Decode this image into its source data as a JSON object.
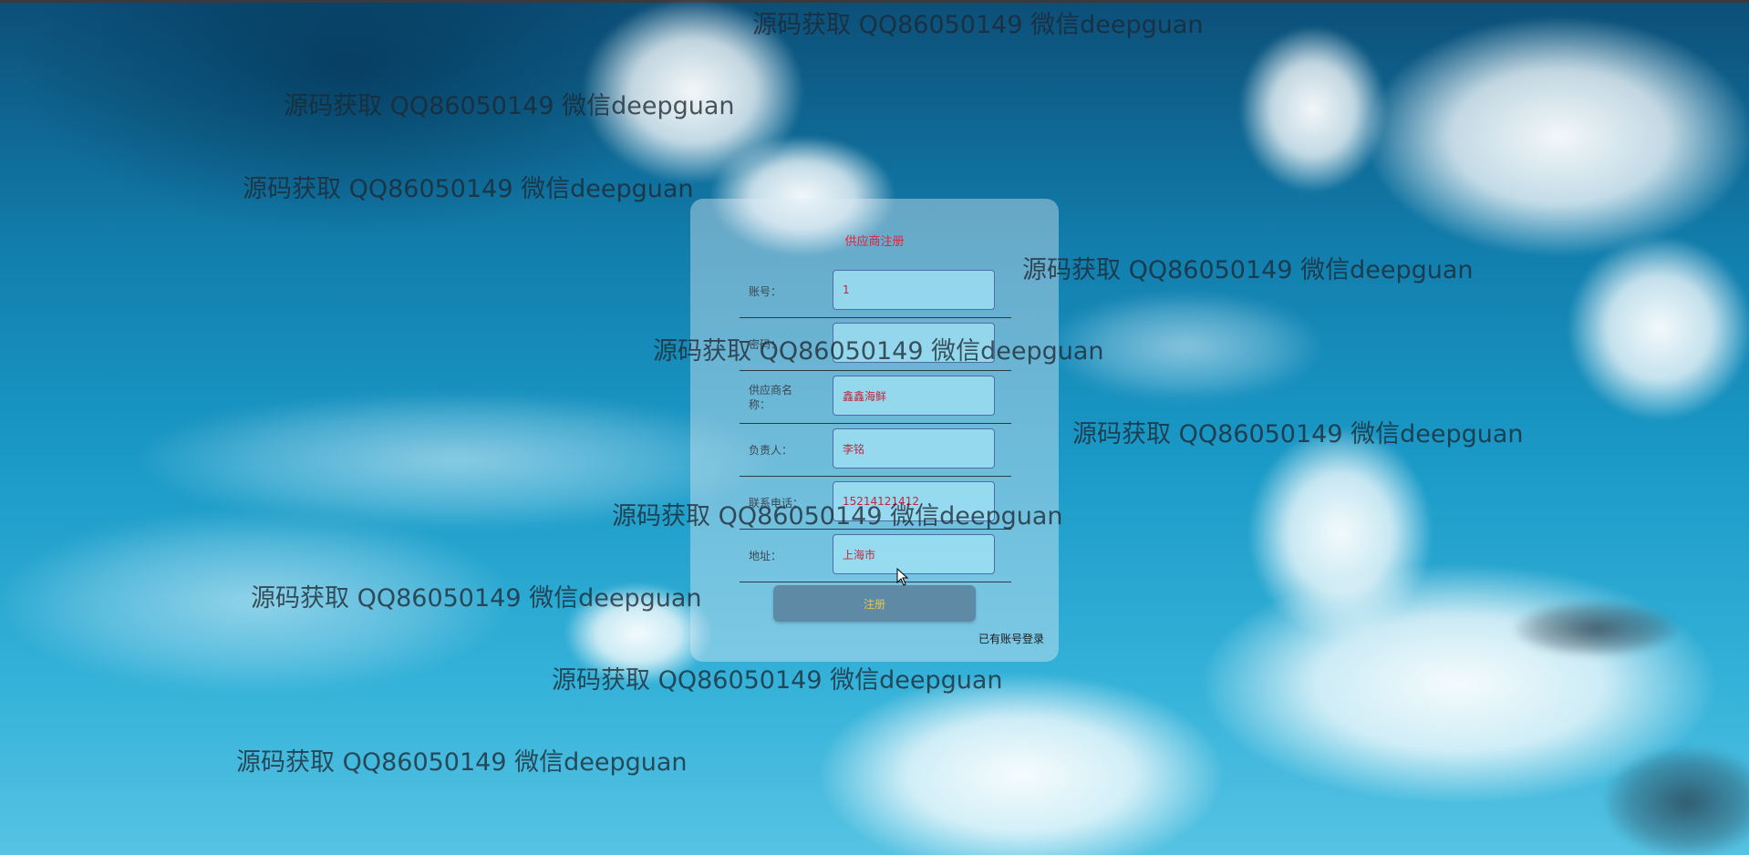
{
  "form": {
    "title": "供应商注册",
    "fields": [
      {
        "label": "账号：",
        "value": "1"
      },
      {
        "label": "密码：",
        "value": ""
      },
      {
        "label": "供应商名称：",
        "value": "鑫鑫海鲜"
      },
      {
        "label": "负责人：",
        "value": "李铭"
      },
      {
        "label": "联系电话：",
        "value": "15214121412"
      },
      {
        "label": "地址：",
        "value": "上海市"
      }
    ],
    "submit_label": "注册",
    "login_link": "已有账号登录"
  },
  "watermark_text": "源码获取 QQ86050149 微信deepguan",
  "colors": {
    "title": "#e8213a",
    "input_text": "#c0283c",
    "button_bg": "#5e8aa6",
    "button_text": "#e9c44a"
  }
}
